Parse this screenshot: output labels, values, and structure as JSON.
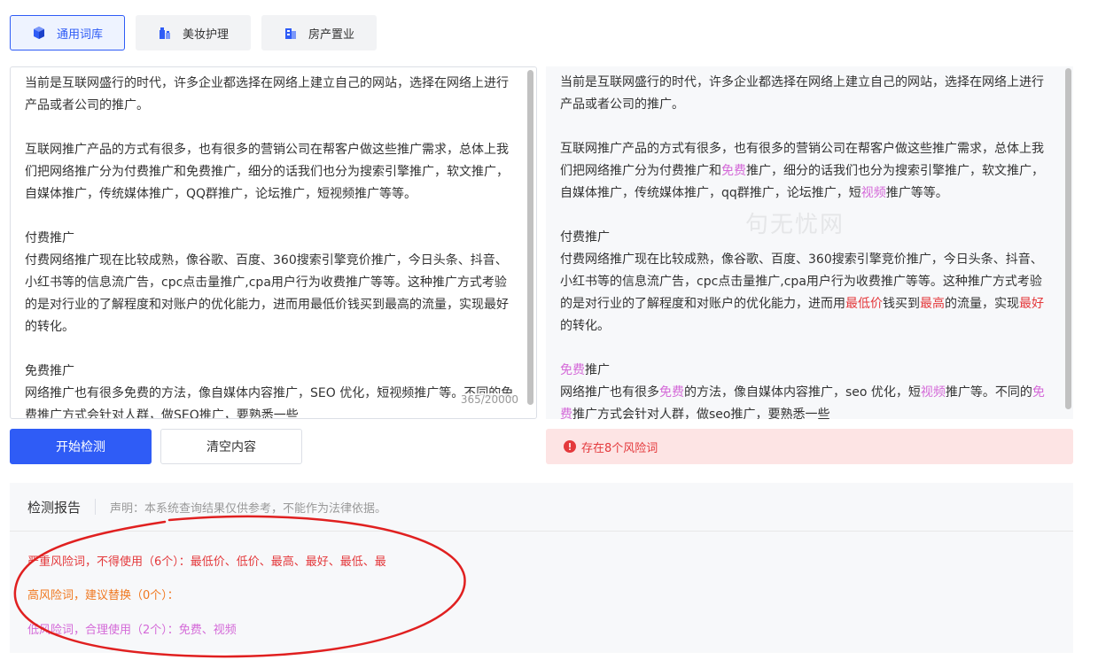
{
  "tabs": [
    {
      "label": "通用词库",
      "icon": "cube-icon",
      "active": true
    },
    {
      "label": "美妆护理",
      "icon": "cosmetics-icon",
      "active": false
    },
    {
      "label": "房产置业",
      "icon": "building-icon",
      "active": false
    }
  ],
  "input": {
    "paragraphs": [
      "当前是互联网盛行的时代，许多企业都选择在网络上建立自己的网站，选择在网络上进行产品或者公司的推广。",
      "互联网推广产品的方式有很多，也有很多的营销公司在帮客户做这些推广需求，总体上我们把网络推广分为付费推广和免费推广，细分的话我们也分为搜索引擎推广，软文推广，自媒体推广，传统媒体推广，QQ群推广，论坛推广，短视频推广等等。",
      "付费推广",
      "付费网络推广现在比较成熟，像谷歌、百度、360搜索引擎竞价推广，今日头条、抖音、小红书等的信息流广告，cpc点击量推广,cpa用户行为收费推广等等。这种推广方式考验的是对行业的了解程度和对账户的优化能力，进而用最低价钱买到最高的流量，实现最好的转化。",
      "免费推广",
      "网络推广也有很多免费的方法，像自媒体内容推广，SEO 优化，短视频推广等。不同的免费推广方式会针对人群，做SEO推广，要熟悉一些"
    ],
    "counter": "365/20000"
  },
  "output": {
    "paragraphs": [
      [
        {
          "t": "当前是互联网盛行的时代，许多企业都选择在网络上建立自己的网站，选择在网络上进行产品或者公司的推广。"
        }
      ],
      [
        {
          "t": "互联网推广产品的方式有很多，也有很多的营销公司在帮客户做这些推广需求，总体上我们把网络推广分为付费推广和"
        },
        {
          "t": "免费",
          "lvl": "low"
        },
        {
          "t": "推广，细分的话我们也分为搜索引擎推广，软文推广，自媒体推广，传统媒体推广，qq群推广，论坛推广，短"
        },
        {
          "t": "视频",
          "lvl": "low"
        },
        {
          "t": "推广等等。"
        }
      ],
      [
        {
          "t": "付费推广"
        }
      ],
      [
        {
          "t": "付费网络推广现在比较成熟，像谷歌、百度、360搜索引擎竞价推广，今日头条、抖音、小红书等的信息流广告，cpc点击量推广,cpa用户行为收费推广等等。这种推广方式考验的是对行业的了解程度和对账户的优化能力，进而用"
        },
        {
          "t": "最低价",
          "lvl": "sev"
        },
        {
          "t": "钱买到"
        },
        {
          "t": "最高",
          "lvl": "sev"
        },
        {
          "t": "的流量，实现"
        },
        {
          "t": "最好",
          "lvl": "sev"
        },
        {
          "t": "的转化。"
        }
      ],
      [
        {
          "t": "免费",
          "lvl": "low"
        },
        {
          "t": "推广"
        }
      ],
      [
        {
          "t": "网络推广也有很多"
        },
        {
          "t": "免费",
          "lvl": "low"
        },
        {
          "t": "的方法，像自媒体内容推广，seo 优化，短"
        },
        {
          "t": "视频",
          "lvl": "low"
        },
        {
          "t": "推广等。不同的"
        },
        {
          "t": "免费",
          "lvl": "low"
        },
        {
          "t": "推广方式会针对人群，做seo推广，要熟悉一些"
        }
      ]
    ],
    "watermark": "句无忧网"
  },
  "buttons": {
    "start": "开始检测",
    "clear": "清空内容"
  },
  "alert": {
    "text": "存在8个风险词",
    "icon": "exclamation-circle-icon"
  },
  "report": {
    "title": "检测报告",
    "declaration": "声明：本系统查询结果仅供参考，不能作为法律依据。",
    "lines": [
      "严重风险词，不得使用（6个）：最低价、低价、最高、最好、最低、最",
      "高风险词，建议替换（0个）：",
      "低风险词，合理使用（2个）：免费、视频"
    ]
  },
  "colors": {
    "primary": "#2f5cf6",
    "severe": "#e4393c",
    "high": "#f07820",
    "low": "#d46ad8",
    "annotation": "#e02020"
  }
}
